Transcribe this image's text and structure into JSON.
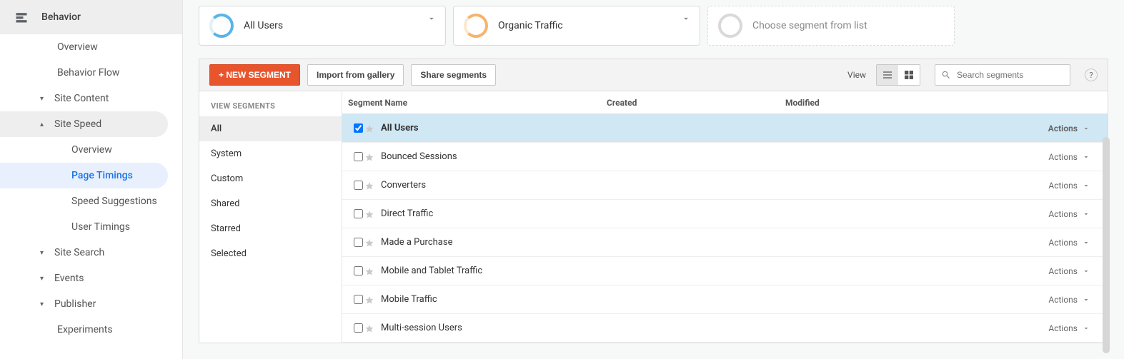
{
  "nav": {
    "section": "Behavior",
    "items": [
      {
        "label": "Overview",
        "type": "item"
      },
      {
        "label": "Behavior Flow",
        "type": "item"
      },
      {
        "label": "Site Content",
        "type": "toggle",
        "expanded": false
      },
      {
        "label": "Site Speed",
        "type": "toggle",
        "expanded": true,
        "highlight": true,
        "children": [
          {
            "label": "Overview"
          },
          {
            "label": "Page Timings",
            "active": true
          },
          {
            "label": "Speed Suggestions"
          },
          {
            "label": "User Timings"
          }
        ]
      },
      {
        "label": "Site Search",
        "type": "toggle",
        "expanded": false
      },
      {
        "label": "Events",
        "type": "toggle",
        "expanded": false
      },
      {
        "label": "Publisher",
        "type": "toggle",
        "expanded": false
      },
      {
        "label": "Experiments",
        "type": "item"
      }
    ]
  },
  "segments": {
    "pills": [
      {
        "label": "All Users",
        "color": "c1"
      },
      {
        "label": "Organic Traffic",
        "color": "c2"
      }
    ],
    "add_placeholder": "Choose segment from list",
    "toolbar": {
      "new_label": "+ NEW SEGMENT",
      "import_label": "Import from gallery",
      "share_label": "Share segments",
      "view_label": "View",
      "search_placeholder": "Search segments"
    },
    "filters": {
      "heading": "VIEW SEGMENTS",
      "items": [
        "All",
        "System",
        "Custom",
        "Shared",
        "Starred",
        "Selected"
      ],
      "active": "All"
    },
    "table": {
      "headers": {
        "name": "Segment Name",
        "created": "Created",
        "modified": "Modified"
      },
      "actions_label": "Actions",
      "rows": [
        {
          "name": "All Users",
          "checked": true,
          "starred": false,
          "selected": true
        },
        {
          "name": "Bounced Sessions",
          "checked": false,
          "starred": false
        },
        {
          "name": "Converters",
          "checked": false,
          "starred": false
        },
        {
          "name": "Direct Traffic",
          "checked": false,
          "starred": false
        },
        {
          "name": "Made a Purchase",
          "checked": false,
          "starred": false
        },
        {
          "name": "Mobile and Tablet Traffic",
          "checked": false,
          "starred": false
        },
        {
          "name": "Mobile Traffic",
          "checked": false,
          "starred": false
        },
        {
          "name": "Multi-session Users",
          "checked": false,
          "starred": false
        }
      ]
    }
  }
}
